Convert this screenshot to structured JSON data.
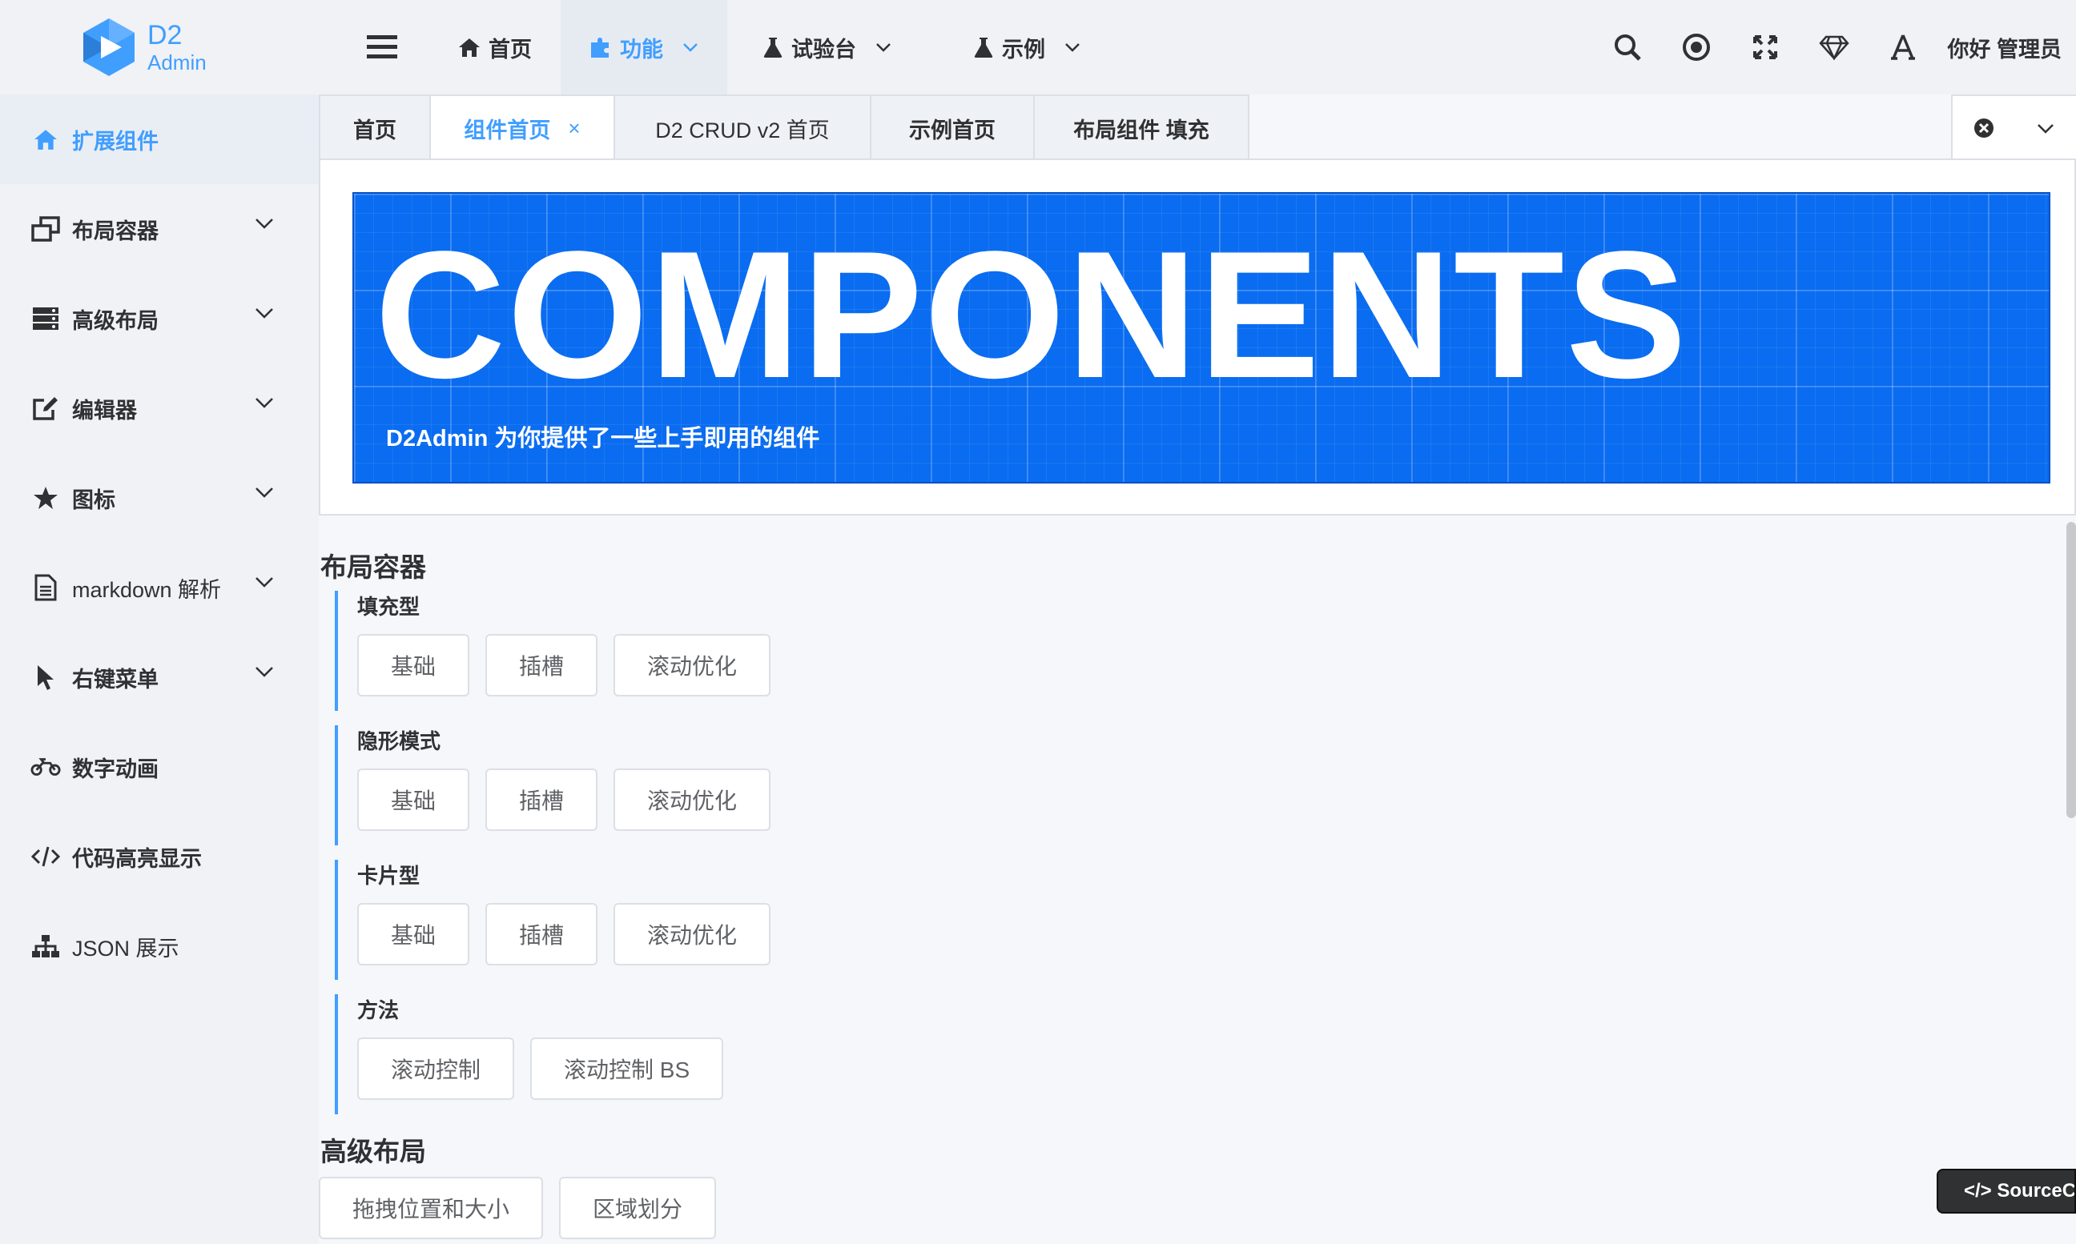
{
  "brand": {
    "name": "D2",
    "sub": "Admin",
    "accent": "#409eff"
  },
  "topnav": {
    "items": [
      {
        "label": "首页",
        "icon": "home-icon",
        "active": false,
        "has_menu": false
      },
      {
        "label": "功能",
        "icon": "puzzle-icon",
        "active": true,
        "has_menu": true
      },
      {
        "label": "试验台",
        "icon": "flask-icon",
        "active": false,
        "has_menu": true
      },
      {
        "label": "示例",
        "icon": "flask-icon",
        "active": false,
        "has_menu": true
      }
    ],
    "user": "你好 管理员"
  },
  "sidebar": {
    "items": [
      {
        "label": "扩展组件",
        "icon": "home-icon"
      },
      {
        "label": "布局容器",
        "icon": "window-restore-icon"
      },
      {
        "label": "高级布局",
        "icon": "server-icon"
      },
      {
        "label": "编辑器",
        "icon": "edit-icon"
      },
      {
        "label": "图标",
        "icon": "star-icon"
      },
      {
        "label": "markdown 解析",
        "icon": "file-text-icon"
      },
      {
        "label": "右键菜单",
        "icon": "mouse-pointer-icon"
      },
      {
        "label": "数字动画",
        "icon": "motorcycle-icon"
      },
      {
        "label": "代码高亮显示",
        "icon": "code-icon"
      },
      {
        "label": "JSON 展示",
        "icon": "sitemap-icon"
      }
    ]
  },
  "tabs": {
    "items": [
      {
        "label": "首页"
      },
      {
        "label": "组件首页",
        "close": "×"
      },
      {
        "label": "D2 CRUD v2 首页"
      },
      {
        "label": "示例首页"
      },
      {
        "label": "布局组件 填充"
      }
    ]
  },
  "banner": {
    "title": "COMPONENTS",
    "subtitle": "D2Admin 为你提供了一些上手即用的组件"
  },
  "sections": {
    "layout": {
      "title": "布局容器",
      "groups": [
        {
          "title": "填充型",
          "buttons": [
            "基础",
            "插槽",
            "滚动优化"
          ]
        },
        {
          "title": "隐形模式",
          "buttons": [
            "基础",
            "插槽",
            "滚动优化"
          ]
        },
        {
          "title": "卡片型",
          "buttons": [
            "基础",
            "插槽",
            "滚动优化"
          ]
        },
        {
          "title": "方法",
          "buttons": [
            "滚动控制",
            "滚动控制 BS"
          ]
        }
      ]
    },
    "advanced": {
      "title": "高级布局",
      "buttons": [
        "拖拽位置和大小",
        "区域划分"
      ]
    }
  },
  "source_badge": "</> SourceCode"
}
